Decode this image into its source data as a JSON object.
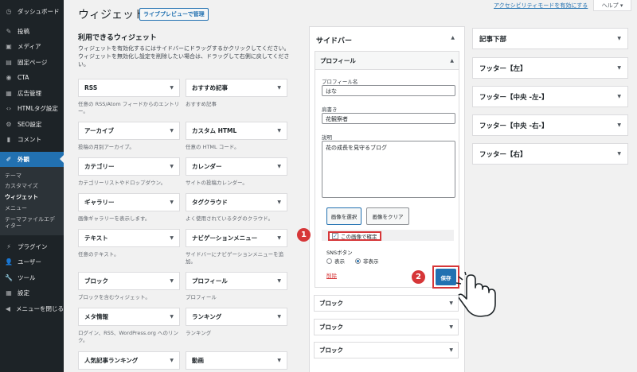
{
  "admin_menu": {
    "items": [
      {
        "label": "ダッシュボード",
        "icon": "dashboard-icon",
        "glyph": "◷"
      },
      {
        "label": "投稿",
        "icon": "pin-icon",
        "glyph": "✎"
      },
      {
        "label": "メディア",
        "icon": "media-icon",
        "glyph": "▣"
      },
      {
        "label": "固定ページ",
        "icon": "page-icon",
        "glyph": "▤"
      },
      {
        "label": "CTA",
        "icon": "cta-icon",
        "glyph": "◉"
      },
      {
        "label": "広告管理",
        "icon": "ad-icon",
        "glyph": "▦"
      },
      {
        "label": "HTMLタグ設定",
        "icon": "code-icon",
        "glyph": "‹›"
      },
      {
        "label": "SEO設定",
        "icon": "seo-icon",
        "glyph": "⚙"
      },
      {
        "label": "コメント",
        "icon": "comment-icon",
        "glyph": "▮"
      },
      {
        "label": "外観",
        "icon": "appearance-icon",
        "glyph": "✐"
      }
    ],
    "submenu": [
      "テーマ",
      "カスタマイズ",
      "ウィジェット",
      "メニュー",
      "テーマファイルエディター"
    ],
    "submenu_current": "ウィジェット",
    "bottom_items": [
      {
        "label": "プラグイン",
        "icon": "plugin-icon",
        "glyph": "⚡"
      },
      {
        "label": "ユーザー",
        "icon": "users-icon",
        "glyph": "👤"
      },
      {
        "label": "ツール",
        "icon": "tools-icon",
        "glyph": "🔧"
      },
      {
        "label": "設定",
        "icon": "settings-icon",
        "glyph": "▦"
      },
      {
        "label": "メニューを閉じる",
        "icon": "collapse-icon",
        "glyph": "◀"
      }
    ]
  },
  "header": {
    "title": "ウィジェット",
    "live_preview": "ライブプレビューで管理",
    "a11y_link": "アクセシビリティモードを有効にする",
    "help": "ヘルプ ▾"
  },
  "available": {
    "title": "利用できるウィジェット",
    "description": "ウィジェットを有効化するにはサイドバーにドラッグするかクリックしてください。ウィジェットを無効化し設定を削除したい場合は、ドラッグして右側に戻してください。",
    "widgets": [
      {
        "name": "RSS",
        "desc": "任意の RSS/Atom フィードからのエントリー。"
      },
      {
        "name": "おすすめ記事",
        "desc": "おすすめ記事"
      },
      {
        "name": "アーカイブ",
        "desc": "投稿の月別アーカイブ。"
      },
      {
        "name": "カスタム HTML",
        "desc": "任意の HTML コード。"
      },
      {
        "name": "カテゴリー",
        "desc": "カテゴリーリストやドロップダウン。"
      },
      {
        "name": "カレンダー",
        "desc": "サイトの投稿カレンダー。"
      },
      {
        "name": "ギャラリー",
        "desc": "画像ギャラリーを表示します。"
      },
      {
        "name": "タグクラウド",
        "desc": "よく使用されているタグのクラウド。"
      },
      {
        "name": "テキスト",
        "desc": "任意のテキスト。"
      },
      {
        "name": "ナビゲーションメニュー",
        "desc": "サイドバーにナビゲーションメニューを追加。"
      },
      {
        "name": "ブロック",
        "desc": "ブロックを含むウィジェット。"
      },
      {
        "name": "プロフィール",
        "desc": "プロフィール"
      },
      {
        "name": "メタ情報",
        "desc": "ログイン、RSS、WordPress.org へのリンク。"
      },
      {
        "name": "ランキング",
        "desc": "ランキング"
      },
      {
        "name": "人気記事ランキング",
        "desc": ""
      },
      {
        "name": "動画",
        "desc": ""
      }
    ]
  },
  "sidebar_area": {
    "title": "サイドバー",
    "profile_widget": {
      "title": "プロフィール",
      "name_label": "プロフィール名",
      "name_value": "はな",
      "role_label": "肩書き",
      "role_value": "花観察者",
      "desc_label": "説明",
      "desc_value": "花の成長を見守るブログ",
      "select_image": "画像を選択",
      "clear_image": "画像をクリア",
      "confirm_label": "この画像で確定",
      "sns_label": "SNSボタン",
      "sns_options": [
        "表示",
        "非表示"
      ],
      "sns_selected": "非表示",
      "delete_label": "削除",
      "save_label": "保存"
    },
    "blocks": [
      "ブロック",
      "ブロック",
      "ブロック"
    ]
  },
  "right_areas": [
    "記事下部",
    "フッター【左】",
    "フッター【中央 -左-】",
    "フッター【中央 -右-】",
    "フッター【右】"
  ],
  "annotations": {
    "badge1": "1",
    "badge2": "2"
  },
  "colors": {
    "accent": "#2271b1",
    "highlight": "#d63638",
    "menu_bg": "#1d2327"
  }
}
